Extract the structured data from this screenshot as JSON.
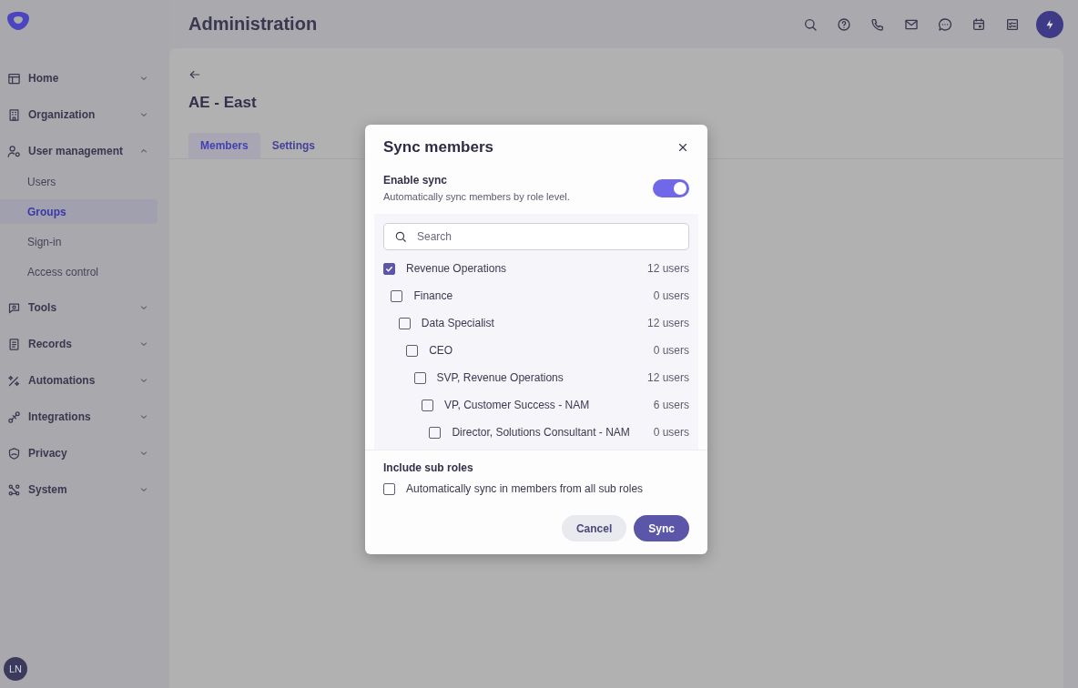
{
  "app": {
    "title": "Administration"
  },
  "sidebar": {
    "items": [
      {
        "label": "Home",
        "expanded": false
      },
      {
        "label": "Organization",
        "expanded": false
      },
      {
        "label": "User management",
        "expanded": true,
        "children": [
          {
            "label": "Users",
            "selected": false
          },
          {
            "label": "Groups",
            "selected": true
          },
          {
            "label": "Sign-in",
            "selected": false
          },
          {
            "label": "Access control",
            "selected": false
          }
        ]
      },
      {
        "label": "Tools",
        "expanded": false
      },
      {
        "label": "Records",
        "expanded": false
      },
      {
        "label": "Automations",
        "expanded": false
      },
      {
        "label": "Integrations",
        "expanded": false
      },
      {
        "label": "Privacy",
        "expanded": false
      },
      {
        "label": "System",
        "expanded": false
      }
    ],
    "user_initials": "LN"
  },
  "page": {
    "title": "AE - East",
    "tabs": [
      {
        "label": "Members",
        "selected": true
      },
      {
        "label": "Settings",
        "selected": false
      }
    ]
  },
  "dialog": {
    "title": "Sync members",
    "enable_sync": {
      "label": "Enable sync",
      "description": "Automatically sync members by role level.",
      "on": true
    },
    "search": {
      "placeholder": "Search"
    },
    "roles": [
      {
        "label": "Revenue Operations",
        "count": "12 users",
        "checked": true,
        "children": [
          {
            "label": "Finance",
            "count": "0 users",
            "checked": false,
            "children": [
              {
                "label": "Data Specialist",
                "count": "12 users",
                "checked": false,
                "children": [
                  {
                    "label": "CEO",
                    "count": "0 users",
                    "checked": false,
                    "children": [
                      {
                        "label": "SVP, Revenue Operations",
                        "count": "12 users",
                        "checked": false,
                        "children": [
                          {
                            "label": "VP, Customer Success - NAM",
                            "count": "6 users",
                            "checked": false,
                            "children": [
                              {
                                "label": "Director, Solutions Consultant - NAM",
                                "count": "0 users",
                                "checked": false
                              }
                            ]
                          }
                        ]
                      }
                    ]
                  }
                ]
              }
            ]
          }
        ]
      }
    ],
    "sub_roles": {
      "heading": "Include sub roles",
      "label": "Automatically sync in members from all sub roles",
      "checked": false
    },
    "buttons": [
      {
        "label": "Cancel",
        "kind": "secondary"
      },
      {
        "label": "Sync",
        "kind": "primary"
      }
    ]
  }
}
